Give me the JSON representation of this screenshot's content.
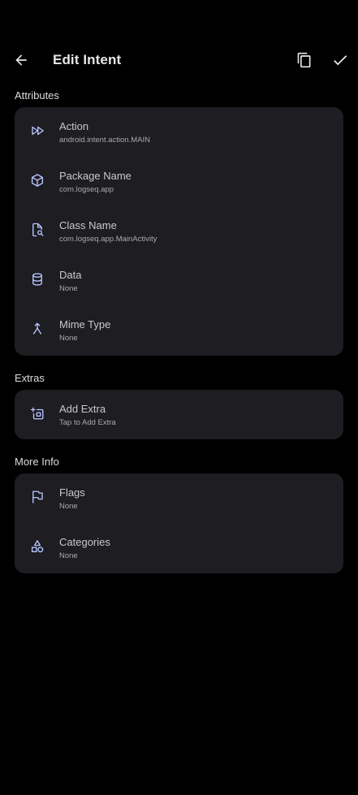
{
  "header": {
    "title": "Edit Intent"
  },
  "sections": {
    "attributes": {
      "label": "Attributes",
      "items": [
        {
          "title": "Action",
          "value": "android.intent.action.MAIN",
          "icon": "fast-forward-icon"
        },
        {
          "title": "Package Name",
          "value": "com.logseq.app",
          "icon": "package-icon"
        },
        {
          "title": "Class Name",
          "value": "com.logseq.app.MainActivity",
          "icon": "file-search-icon"
        },
        {
          "title": "Data",
          "value": "None",
          "icon": "database-icon"
        },
        {
          "title": "Mime Type",
          "value": "None",
          "icon": "merge-icon"
        }
      ]
    },
    "extras": {
      "label": "Extras",
      "items": [
        {
          "title": "Add Extra",
          "value": "Tap to Add Extra",
          "icon": "add-extra-icon"
        }
      ]
    },
    "more_info": {
      "label": "More Info",
      "items": [
        {
          "title": "Flags",
          "value": "None",
          "icon": "flag-icon"
        },
        {
          "title": "Categories",
          "value": "None",
          "icon": "shapes-icon"
        }
      ]
    }
  },
  "colors": {
    "background": "#000000",
    "card": "#1d1d22",
    "icon_accent": "#b9c6ff",
    "text_primary": "#e6e6e9",
    "text_secondary": "#a9a9ae"
  }
}
